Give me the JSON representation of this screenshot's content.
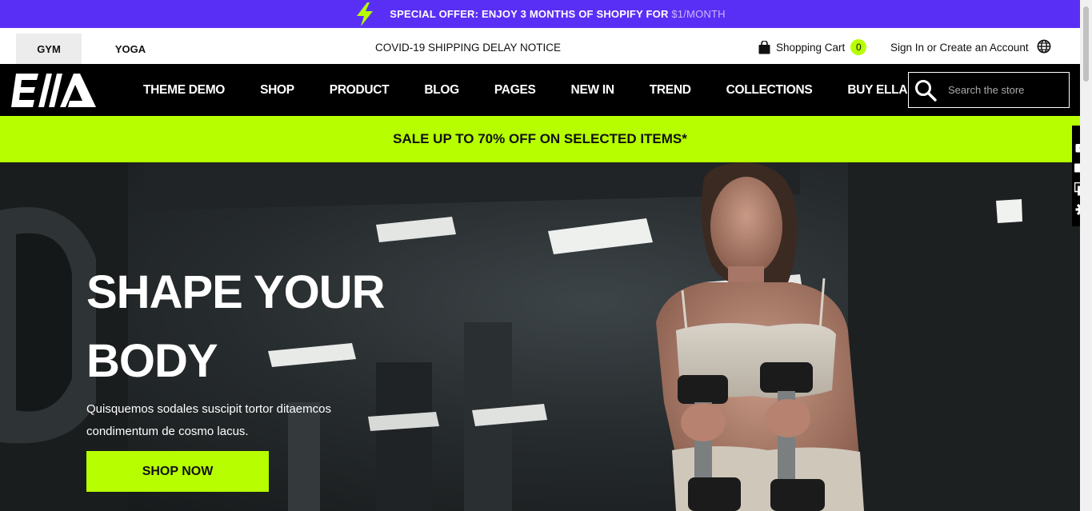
{
  "promo": {
    "text": "SPECIAL OFFER: ENJOY 3 MONTHS OF SHOPIFY FOR",
    "price": "$1/MONTH",
    "icon": "lightning-bolt-icon",
    "color": "#5a2ff5"
  },
  "topbar": {
    "tabs": [
      {
        "label": "GYM",
        "active": true
      },
      {
        "label": "YOGA",
        "active": false
      }
    ],
    "notice": "COVID-19 SHIPPING DELAY NOTICE",
    "cart_label": "Shopping Cart",
    "cart_count": "0",
    "account_label": "Sign In or Create an Account",
    "globe_icon": "globe-icon"
  },
  "nav": {
    "logo": "Ella",
    "items": [
      {
        "label": "THEME DEMO"
      },
      {
        "label": "SHOP"
      },
      {
        "label": "PRODUCT"
      },
      {
        "label": "BLOG"
      },
      {
        "label": "PAGES"
      },
      {
        "label": "NEW IN"
      },
      {
        "label": "TREND"
      },
      {
        "label": "COLLECTIONS"
      },
      {
        "label": "BUY ELLA"
      }
    ],
    "search_placeholder": "Search the store"
  },
  "sale": {
    "text": "SALE UP TO 70% OFF ON SELECTED ITEMS*",
    "color": "#b7ff00"
  },
  "hero": {
    "title_line1": "SHAPE YOUR",
    "title_line2": "BODY",
    "description": "Quisquemos sodales suscipit tortor ditaemcos condimentum de cosmo lacus.",
    "cta": "SHOP NOW"
  },
  "side_tools": [
    "camera-icon",
    "video-icon",
    "window-icon",
    "settings-icon"
  ]
}
